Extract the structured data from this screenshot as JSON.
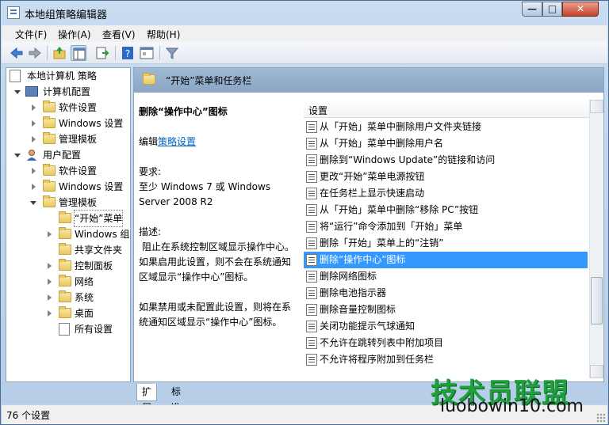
{
  "window": {
    "title": "本地组策略编辑器",
    "min_label": "—",
    "max_label": "□",
    "close_label": "✕"
  },
  "menu": {
    "items": [
      {
        "label": "文件(F)"
      },
      {
        "label": "操作(A)"
      },
      {
        "label": "查看(V)"
      },
      {
        "label": "帮助(H)"
      }
    ]
  },
  "toolbar": {
    "buttons": [
      "back-arrow-icon",
      "forward-arrow-icon",
      "up-folder-icon",
      "show-hide-tree-icon",
      "export-list-icon",
      "help-icon",
      "properties-icon",
      "filter-icon"
    ]
  },
  "tree": {
    "items": [
      {
        "label": "本地计算机 策略"
      },
      {
        "label": "计算机配置"
      },
      {
        "label": "软件设置"
      },
      {
        "label": "Windows 设置"
      },
      {
        "label": "管理模板"
      },
      {
        "label": "用户配置"
      },
      {
        "label": "软件设置"
      },
      {
        "label": "Windows 设置"
      },
      {
        "label": "管理模板"
      },
      {
        "label": "“开始”菜单"
      },
      {
        "label": "Windows 组"
      },
      {
        "label": "共享文件夹"
      },
      {
        "label": "控制面板"
      },
      {
        "label": "网络"
      },
      {
        "label": "系统"
      },
      {
        "label": "桌面"
      },
      {
        "label": "所有设置"
      }
    ]
  },
  "main": {
    "header": "“开始”菜单和任务栏",
    "description": {
      "title": "删除“操作中心”图标",
      "edit_prefix": "编辑",
      "edit_link": "策略设置",
      "req_label": "要求:",
      "req_text": "至少 Windows 7 或 Windows Server 2008 R2",
      "desc_label": "描述:",
      "desc_text": "阻止在系统控制区域显示操作中心。如果启用此设置，则不会在系统通知区域显示“操作中心”图标。",
      "desc_text2": "如果禁用或未配置此设置，则将在系统通知区域显示“操作中心”图标。"
    },
    "column_header": "设置",
    "settings": [
      "从「开始」菜单中删除用户文件夹链接",
      "从「开始」菜单中删除用户名",
      "删除到“Windows Update”的链接和访问",
      "更改“开始”菜单电源按钮",
      "在任务栏上显示快速启动",
      "从「开始」菜单中删除“移除 PC”按钮",
      "将“运行”命令添加到「开始」菜单",
      "删除「开始」菜单上的“注销”",
      "删除“操作中心”图标",
      "删除网络图标",
      "删除电池指示器",
      "删除音量控制图标",
      "关闭功能提示气球通知",
      "不允许在跳转列表中附加项目",
      "不允许将程序附加到任务栏"
    ],
    "selected_index": 8
  },
  "tabs": [
    {
      "label": "扩展"
    },
    {
      "label": "标准"
    }
  ],
  "status": {
    "text": "76 个设置"
  },
  "watermark": {
    "top": "技术员联盟",
    "bottom": "luobowin10.com"
  }
}
